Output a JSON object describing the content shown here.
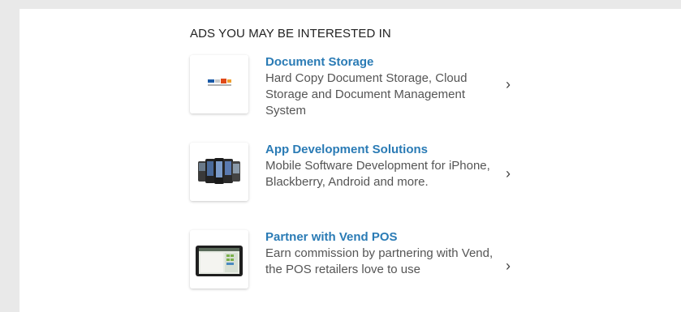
{
  "section": {
    "heading": "ADS YOU MAY BE INTERESTED IN"
  },
  "ads": [
    {
      "title": "Document Storage",
      "description": "Hard Copy Document Storage, Cloud Storage and Document Management System",
      "thumbnail_icon": "document-storage-logo-icon",
      "chevron": "›"
    },
    {
      "title": "App Development Solutions",
      "description": "Mobile Software Development for iPhone, Blackberry, Android and more.",
      "thumbnail_icon": "mobile-phones-icon",
      "chevron": "›"
    },
    {
      "title": "Partner with Vend POS",
      "description": "Earn commission by partnering with Vend, the POS retailers love to use",
      "thumbnail_icon": "tablet-pos-icon",
      "chevron": "›"
    }
  ],
  "colors": {
    "page_background": "#e9e9e9",
    "panel_background": "#ffffff",
    "link_blue": "#2a7bb5",
    "body_text": "#555555",
    "heading_text": "#222222"
  }
}
